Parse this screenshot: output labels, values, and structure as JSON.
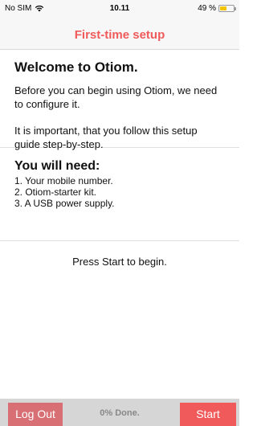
{
  "status_bar": {
    "carrier": "No SIM",
    "wifi_icon": "wifi-icon",
    "time": "10.11",
    "battery_percent_text": "49 %",
    "battery_icon": "battery-icon",
    "battery_level": 0.49,
    "battery_color": "#f5c400"
  },
  "nav": {
    "title": "First-time setup",
    "title_color": "#f05a5b"
  },
  "welcome": {
    "heading": "Welcome to Otiom.",
    "para1": "Before you can begin using Otiom, we need to configure it.",
    "para2": "It is important, that you follow this setup guide step-by-step."
  },
  "needs": {
    "heading": "You will need:",
    "items": [
      "1. Your mobile number.",
      "2. Otiom-starter kit.",
      "3. A USB power supply."
    ]
  },
  "prompt": "Press Start to begin.",
  "footer": {
    "logout_label": "Log Out",
    "progress_text": "0% Done.",
    "progress_value": 0,
    "start_label": "Start",
    "accent_color": "#f05a5b"
  }
}
